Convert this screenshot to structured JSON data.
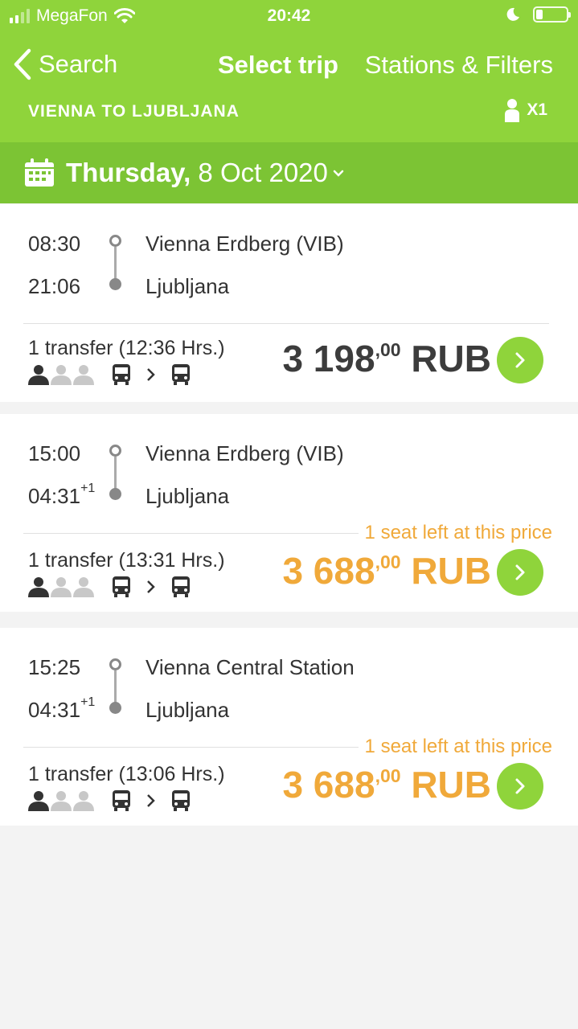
{
  "status_bar": {
    "carrier": "MegaFon",
    "time": "20:42",
    "battery_level": 0.2
  },
  "nav": {
    "back_label": "Search",
    "title": "Select trip",
    "filters_label": "Stations & Filters"
  },
  "route": "VIENNA TO LJUBLJANA",
  "passengers": "X1",
  "date": {
    "weekday": "Thursday,",
    "rest": " 8 Oct 2020"
  },
  "trips": [
    {
      "dep_time": "08:30",
      "arr_time": "21:06",
      "arr_day_offset": "",
      "from": "Vienna Erdberg (VIB)",
      "to": "Ljubljana",
      "transfer": "1 transfer (12:36 Hrs.)",
      "seat_note": "",
      "price_main": "3 198",
      "price_cents": ",00",
      "currency": "RUB",
      "price_color": "#3c3c3c"
    },
    {
      "dep_time": "15:00",
      "arr_time": "04:31",
      "arr_day_offset": "+1",
      "from": "Vienna Erdberg (VIB)",
      "to": "Ljubljana",
      "transfer": "1 transfer (13:31 Hrs.)",
      "seat_note": "1 seat left at this price",
      "price_main": "3 688",
      "price_cents": ",00",
      "currency": "RUB",
      "price_color": "#f0a93a"
    },
    {
      "dep_time": "15:25",
      "arr_time": "04:31",
      "arr_day_offset": "+1",
      "from": "Vienna Central Station",
      "to": "Ljubljana",
      "transfer": "1 transfer (13:06 Hrs.)",
      "seat_note": "1 seat left at this price",
      "price_main": "3 688",
      "price_cents": ",00",
      "currency": "RUB",
      "price_color": "#f0a93a"
    }
  ],
  "colors": {
    "brand_green": "#8fd43b",
    "date_green": "#7cc434",
    "warning_orange": "#f0a93a"
  },
  "icons": [
    "signal-icon",
    "wifi-icon",
    "moon-icon",
    "battery-icon",
    "back-chevron-icon",
    "person-icon",
    "calendar-icon",
    "chevron-down-icon",
    "bus-icon",
    "chevron-right-icon"
  ]
}
